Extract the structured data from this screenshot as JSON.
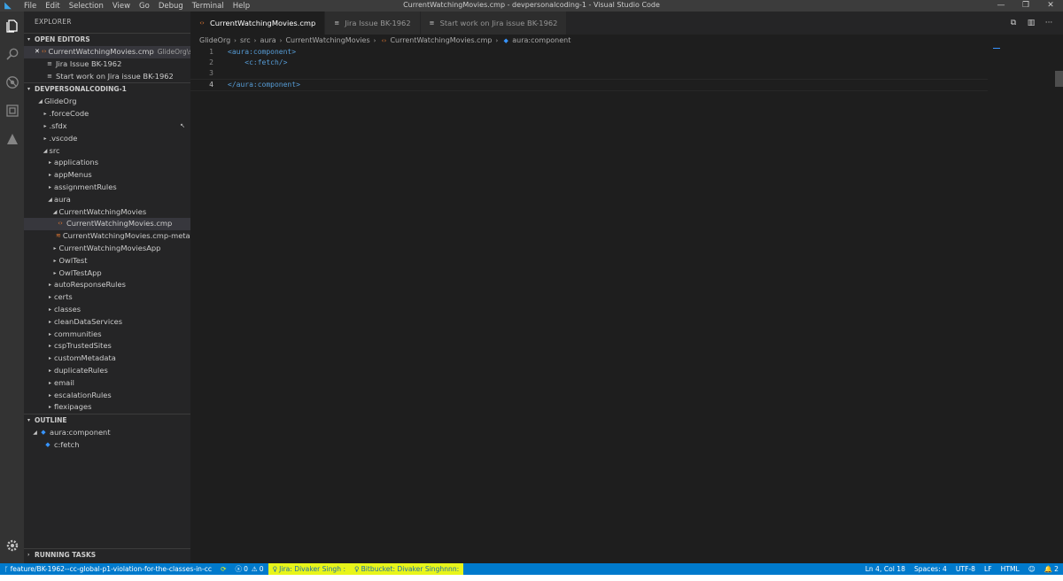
{
  "window": {
    "title": "CurrentWatchingMovies.cmp - devpersonalcoding-1 - Visual Studio Code",
    "menu": [
      "File",
      "Edit",
      "Selection",
      "View",
      "Go",
      "Debug",
      "Terminal",
      "Help"
    ],
    "controls": [
      "—",
      "❐",
      "✕"
    ]
  },
  "activity_bar": {
    "items": [
      "explorer-icon",
      "search-icon",
      "no-bugs-icon",
      "extensions-icon",
      "salesforce-icon"
    ],
    "bottom": "gear-icon"
  },
  "sidebar": {
    "title": "EXPLORER",
    "open_editors": {
      "header": "OPEN EDITORS",
      "items": [
        {
          "name": "CurrentWatchingMovies.cmp",
          "desc": "GlideOrg\\sr...",
          "icon": "cmp"
        },
        {
          "name": "Jira Issue BK-1962",
          "desc": "",
          "icon": "jira"
        },
        {
          "name": "Start work on Jira issue BK-1962",
          "desc": "",
          "icon": "jira"
        }
      ]
    },
    "workspace": {
      "header": "DEVPERSONALCODING-1",
      "tree": [
        {
          "label": "GlideOrg",
          "depth": 0,
          "open": true
        },
        {
          "label": ".forceCode",
          "depth": 1,
          "open": false
        },
        {
          "label": ".sfdx",
          "depth": 1,
          "open": false
        },
        {
          "label": ".vscode",
          "depth": 1,
          "open": false
        },
        {
          "label": "src",
          "depth": 1,
          "open": true
        },
        {
          "label": "applications",
          "depth": 2,
          "open": false
        },
        {
          "label": "appMenus",
          "depth": 2,
          "open": false
        },
        {
          "label": "assignmentRules",
          "depth": 2,
          "open": false
        },
        {
          "label": "aura",
          "depth": 2,
          "open": true
        },
        {
          "label": "CurrentWatchingMovies",
          "depth": 3,
          "open": true
        },
        {
          "label": "CurrentWatchingMovies.cmp",
          "depth": 4,
          "file": "cmp",
          "selected": true
        },
        {
          "label": "CurrentWatchingMovies.cmp-meta.xml",
          "depth": 4,
          "file": "xml"
        },
        {
          "label": "CurrentWatchingMoviesApp",
          "depth": 3,
          "open": false
        },
        {
          "label": "OwlTest",
          "depth": 3,
          "open": false
        },
        {
          "label": "OwlTestApp",
          "depth": 3,
          "open": false
        },
        {
          "label": "autoResponseRules",
          "depth": 2,
          "open": false
        },
        {
          "label": "certs",
          "depth": 2,
          "open": false
        },
        {
          "label": "classes",
          "depth": 2,
          "open": false
        },
        {
          "label": "cleanDataServices",
          "depth": 2,
          "open": false
        },
        {
          "label": "communities",
          "depth": 2,
          "open": false
        },
        {
          "label": "cspTrustedSites",
          "depth": 2,
          "open": false
        },
        {
          "label": "customMetadata",
          "depth": 2,
          "open": false
        },
        {
          "label": "duplicateRules",
          "depth": 2,
          "open": false
        },
        {
          "label": "email",
          "depth": 2,
          "open": false
        },
        {
          "label": "escalationRules",
          "depth": 2,
          "open": false
        },
        {
          "label": "flexipages",
          "depth": 2,
          "open": false
        }
      ]
    },
    "outline": {
      "header": "OUTLINE",
      "items": [
        {
          "label": "aura:component",
          "depth": 0
        },
        {
          "label": "c:fetch",
          "depth": 1
        }
      ]
    },
    "running_tasks": "RUNNING TASKS"
  },
  "tabs": [
    {
      "label": "CurrentWatchingMovies.cmp",
      "active": true,
      "icon": "cmp"
    },
    {
      "label": "Jira Issue BK-1962",
      "active": false,
      "icon": "jira"
    },
    {
      "label": "Start work on Jira issue BK-1962",
      "active": false,
      "icon": "jira"
    }
  ],
  "breadcrumb": [
    "GlideOrg",
    "src",
    "aura",
    "CurrentWatchingMovies",
    "CurrentWatchingMovies.cmp",
    "aura:component"
  ],
  "editor": {
    "lines": [
      {
        "n": "1",
        "parts": [
          [
            "tag",
            "<aura:component>"
          ]
        ]
      },
      {
        "n": "2",
        "parts": [
          [
            "ws",
            "    "
          ],
          [
            "tag",
            "<c:fetch/>"
          ]
        ]
      },
      {
        "n": "3",
        "parts": []
      },
      {
        "n": "4",
        "parts": [
          [
            "hl",
            "</aura:component>"
          ]
        ]
      }
    ],
    "current_line": "4"
  },
  "statusbar": {
    "branch": "feature/BK-1962--cc-global-p1-violation-for-the-classes-in-cc",
    "errors": "0",
    "warnings": "0",
    "jira": "Jira: Divaker Singh :",
    "bitbucket": "Bitbucket: Divaker Singhnnn:",
    "position": "Ln 4, Col 18",
    "spaces": "Spaces: 4",
    "encoding": "UTF-8",
    "eol": "LF",
    "language": "HTML",
    "notifications": "2"
  },
  "colors": {
    "accent": "#007acc",
    "highlight": "#e8f51a",
    "tag": "#569cd6"
  }
}
